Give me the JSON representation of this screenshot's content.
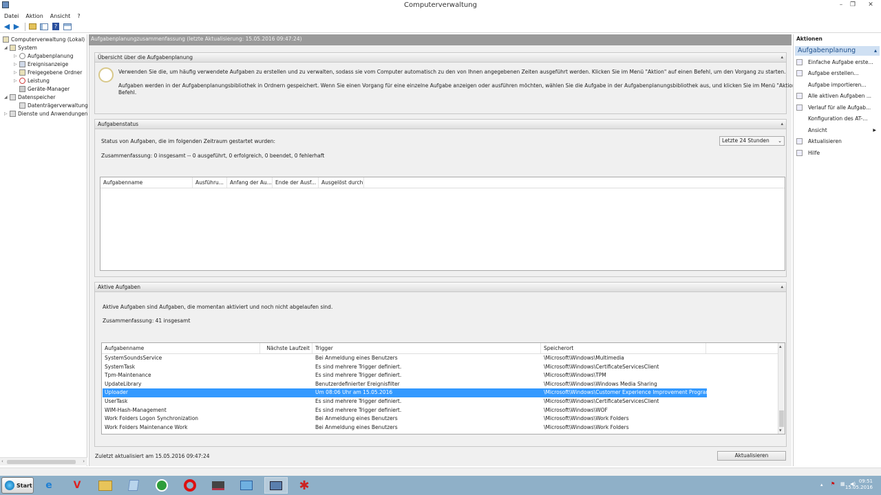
{
  "window": {
    "title": "Computerverwaltung"
  },
  "menubar": [
    "Datei",
    "Aktion",
    "Ansicht",
    "?"
  ],
  "tree": {
    "items": [
      {
        "label": "Computerverwaltung (Lokal)",
        "level": 0
      },
      {
        "label": "System",
        "level": 1
      },
      {
        "label": "Aufgabenplanung",
        "level": 2
      },
      {
        "label": "Ereignisanzeige",
        "level": 2
      },
      {
        "label": "Freigegebene Ordner",
        "level": 2
      },
      {
        "label": "Leistung",
        "level": 2
      },
      {
        "label": "Geräte-Manager",
        "level": 2
      },
      {
        "label": "Datenspeicher",
        "level": 1
      },
      {
        "label": "Datenträgerverwaltung",
        "level": 2
      },
      {
        "label": "Dienste und Anwendungen",
        "level": 1
      }
    ]
  },
  "center": {
    "header": "Aufgabenplanungzusammenfassung (letzte Aktualisierung: 15.05.2016 09:47:24)",
    "overview": {
      "title": "Übersicht über die Aufgabenplanung",
      "text1": "Verwenden Sie die, um häufig verwendete Aufgaben zu erstellen und zu verwalten, sodass sie vom Computer automatisch zu den von Ihnen angegebenen Zeiten ausgeführt werden. Klicken Sie im Menü \"Aktion\" auf einen Befehl, um den Vorgang zu starten.",
      "text2a": "Aufgaben werden in der Aufgabenplanungsbibliothek in Ordnern gespeichert. Wenn Sie einen Vorgang für eine einzelne Aufgabe anzeigen oder ausführen möchten, wählen Sie die Aufgabe in der Aufgabenplanungsbibliothek aus, und klicken Sie im Menü \"Aktion\" auf einen",
      "text2b": "Befehl."
    },
    "status": {
      "title": "Aufgabenstatus",
      "label": "Status von Aufgaben, die im folgenden Zeitraum gestartet wurden:",
      "period": "Letzte 24 Stunden",
      "summary": "Zusammenfassung: 0 insgesamt -- 0 ausgeführt, 0 erfolgreich, 0 beendet, 0 fehlerhaft",
      "columns": [
        "Aufgabenname",
        "Ausführu...",
        "Anfang der Au...",
        "Ende der Ausf...",
        "Ausgelöst durch"
      ]
    },
    "active": {
      "title": "Aktive Aufgaben",
      "desc": "Aktive Aufgaben sind Aufgaben, die momentan aktiviert und noch nicht abgelaufen sind.",
      "summary": "Zusammenfassung: 41 insgesamt",
      "columns": [
        "Aufgabenname",
        "Nächste Laufzeit",
        "Trigger",
        "Speicherort"
      ],
      "rows": [
        {
          "name": "SystemSoundsService",
          "next": "",
          "trigger": "Bei Anmeldung eines Benutzers",
          "location": "\\Microsoft\\Windows\\Multimedia"
        },
        {
          "name": "SystemTask",
          "next": "",
          "trigger": "Es sind mehrere Trigger definiert.",
          "location": "\\Microsoft\\Windows\\CertificateServicesClient"
        },
        {
          "name": "Tpm-Maintenance",
          "next": "",
          "trigger": "Es sind mehrere Trigger definiert.",
          "location": "\\Microsoft\\Windows\\TPM"
        },
        {
          "name": "UpdateLibrary",
          "next": "",
          "trigger": "Benutzerdefinierter Ereignisfilter",
          "location": "\\Microsoft\\Windows\\Windows Media Sharing"
        },
        {
          "name": "Uploader",
          "next": "",
          "trigger": "Um 08:06 Uhr am 15.05.2016",
          "location": "\\Microsoft\\Windows\\Customer Experience Improvement Program",
          "selected": true
        },
        {
          "name": "UserTask",
          "next": "",
          "trigger": "Es sind mehrere Trigger definiert.",
          "location": "\\Microsoft\\Windows\\CertificateServicesClient"
        },
        {
          "name": "WIM-Hash-Management",
          "next": "",
          "trigger": "Es sind mehrere Trigger definiert.",
          "location": "\\Microsoft\\Windows\\WOF"
        },
        {
          "name": "Work Folders Logon Synchronization",
          "next": "",
          "trigger": "Bei Anmeldung eines Benutzers",
          "location": "\\Microsoft\\Windows\\Work Folders"
        },
        {
          "name": "Work Folders Maintenance Work",
          "next": "",
          "trigger": "Bei Anmeldung eines Benutzers",
          "location": "\\Microsoft\\Windows\\Work Folders"
        }
      ]
    },
    "footer": {
      "updated": "Zuletzt aktualisiert am 15.05.2016 09:47:24",
      "refresh": "Aktualisieren"
    }
  },
  "actions": {
    "title": "Aktionen",
    "subtitle": "Aufgabenplanung",
    "items": [
      {
        "label": "Einfache Aufgabe erste...",
        "icon": "wizard-icon"
      },
      {
        "label": "Aufgabe erstellen...",
        "icon": "new-task-icon"
      },
      {
        "label": "Aufgabe importieren...",
        "icon": ""
      },
      {
        "label": "Alle aktiven Aufgaben ...",
        "icon": "list-icon"
      },
      {
        "label": "Verlauf für alle Aufgab...",
        "icon": "history-icon"
      },
      {
        "label": "Konfiguration des AT-...",
        "icon": ""
      },
      {
        "label": "Ansicht",
        "icon": "",
        "submenu": true
      },
      {
        "label": "Aktualisieren",
        "icon": "refresh-icon"
      },
      {
        "label": "Hilfe",
        "icon": "help-icon"
      }
    ]
  },
  "taskbar": {
    "start": "Start",
    "time": "09:51",
    "date": "15.05.2016"
  }
}
